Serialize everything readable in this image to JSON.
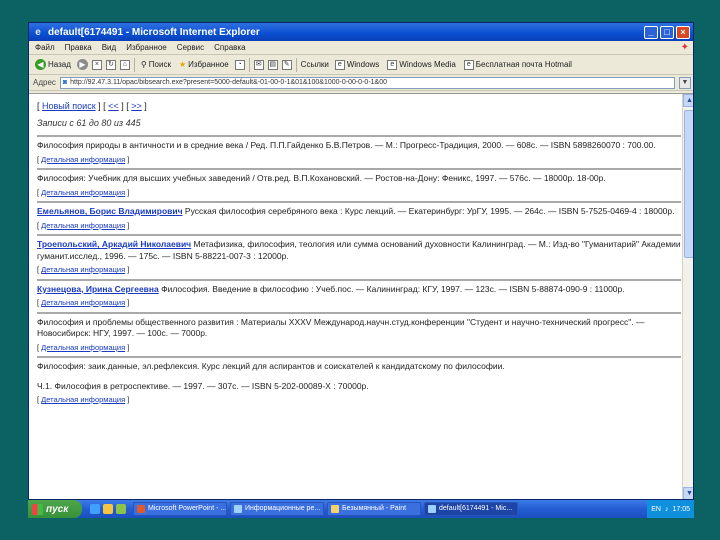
{
  "window": {
    "title": "default[6174491 - Microsoft Internet Explorer",
    "minimize": "_",
    "maximize": "□",
    "close": "×"
  },
  "menubar": [
    "Файл",
    "Правка",
    "Вид",
    "Избранное",
    "Сервис",
    "Справка"
  ],
  "toolbar": {
    "back": "Назад",
    "search": "Поиск",
    "favorites": "Избранное",
    "links_label": "Ссылки",
    "links": [
      "Windows",
      "Windows Media",
      "Бесплатная почта Hotmail"
    ]
  },
  "addressbar": {
    "label": "Адрес",
    "url": "http://92.47.3.11/opac/bibsearch.exe?present=5000-default&-01-00-0-1&01&100&1000-0-00-0-0-1&00"
  },
  "content": {
    "nav": {
      "new_search": "Новый поиск",
      "prev": "<<",
      "next": ">>"
    },
    "count_text": "Записи с 61 до 80 из 445",
    "detail_link": "Детальная информация",
    "records": [
      {
        "author": "",
        "paragraphs": [
          "Философия природы в античности и в средние века / Ред. П.П.Гайденко Б.В.Петров. — М.: Прогресс-Традиция, 2000. — 608с. — ISBN 5898260070 : 700.00."
        ]
      },
      {
        "author": "",
        "paragraphs": [
          "Философия: Учебник для высших учебных заведений / Отв.ред. В.П.Кохановский. — Ростов-на-Дону: Феникс, 1997. — 576с. — 18000р. 18-00р."
        ]
      },
      {
        "author": "Емельянов, Борис Владимирович",
        "paragraphs": [
          "Русская философия серебряного века : Курс лекций. — Екатеринбург: УрГУ, 1995. — 264с. — ISBN 5-7525-0469-4 : 18000р."
        ]
      },
      {
        "author": "Троепольский, Аркадий Николаевич",
        "paragraphs": [
          "Метафизика, философия, теология или сумма оснований духовности Калининград. — М.: Изд-во \"Гуманитарий\" Академии гуманит.исслед., 1996. — 175с. — ISBN 5-88221-007-3 : 12000р."
        ]
      },
      {
        "author": "Кузнецова, Ирина Сергеевна",
        "paragraphs": [
          "Философия. Введение в философию : Учеб.пос. — Калининград: КГУ, 1997. — 123с. — ISBN 5-88874-090-9 : 11000р."
        ]
      },
      {
        "author": "",
        "paragraphs": [
          "Философия и проблемы общественного развития : Материалы XXXV Международ.научн.студ.конференции \"Студент и научно-технический прогресс\". — Новосибирск: НГУ, 1997. — 100с. — 7000р."
        ]
      },
      {
        "author": "",
        "paragraphs": [
          "Философия: заик.данные, эл.рефлексия. Курс лекций для аспирантов и соискателей к кандидатскому по философии.",
          "Ч.1. Философия в ретроспективе. — 1997. — 307с. — ISBN 5-202-00089-X : 70000р."
        ]
      }
    ]
  },
  "taskbar": {
    "start": "пуск",
    "tasks": [
      "Microsoft PowerPoint - ...",
      "Информационные ре...",
      "Безымянный - Paint",
      "default[6174491 - Mic..."
    ],
    "tray_lang": "EN",
    "tray_time": "17:05",
    "colors": {
      "taskbar": "#245dd3",
      "start": "#36913a"
    }
  }
}
